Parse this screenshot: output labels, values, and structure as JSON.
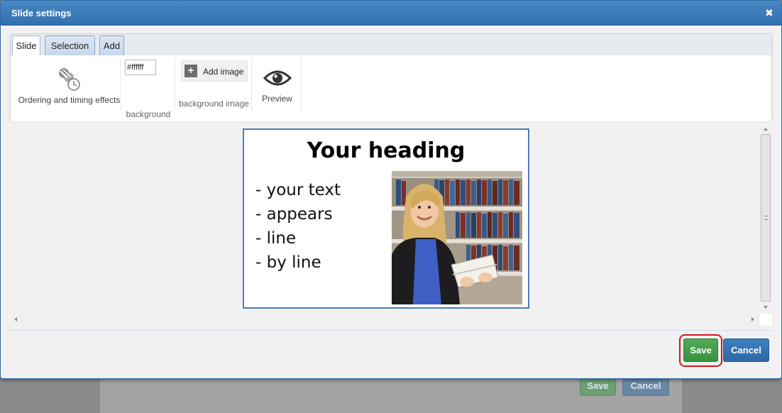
{
  "dialog": {
    "title": "Slide settings",
    "close_glyph": "✖"
  },
  "tabs": [
    {
      "label": "Slide",
      "active": true
    },
    {
      "label": "Selection",
      "active": false
    },
    {
      "label": "Add",
      "active": false
    }
  ],
  "ribbon": {
    "ordering": {
      "label": "Ordering and timing effects",
      "icon": "ordering-timing-icon"
    },
    "background": {
      "value": "#ffffff",
      "label": "background"
    },
    "background_image": {
      "button_label": "Add image",
      "label": "background image",
      "icon": "plus-icon"
    },
    "preview": {
      "label": "Preview",
      "icon": "eye-icon"
    }
  },
  "slide": {
    "heading": "Your heading",
    "lines": [
      "- your text",
      "- appears",
      "- line",
      "- by line"
    ],
    "photo_icon": "woman-with-book-photo"
  },
  "footer": {
    "save_label": "Save",
    "cancel_label": "Cancel"
  },
  "backdrop": {
    "save_label": "Save",
    "cancel_label": "Cancel"
  },
  "colors": {
    "titlebar": "#3a7bbf",
    "save": "#43a047",
    "cancel": "#3474b3",
    "highlight": "#d4171f"
  }
}
